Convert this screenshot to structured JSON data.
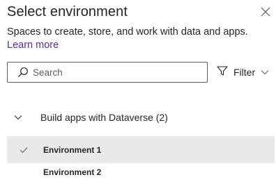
{
  "panel": {
    "title": "Select environment",
    "description": "Spaces to create, store, and work with data and apps.",
    "learn_more": "Learn more"
  },
  "search": {
    "placeholder": "Search",
    "value": ""
  },
  "filter": {
    "label": "Filter"
  },
  "groups": [
    {
      "label": "Build apps with Dataverse (2)",
      "expanded": true,
      "items": [
        {
          "name": "Environment 1",
          "selected": true
        },
        {
          "name": "Environment 2",
          "selected": false
        }
      ]
    }
  ],
  "icons": {
    "close": "close-icon",
    "search": "search-icon",
    "filter": "filter-icon",
    "filter_chevron": "chevron-down-icon",
    "group_chevron": "chevron-down-icon",
    "check": "checkmark-icon"
  },
  "colors": {
    "link": "#5b2d90",
    "selected_row": "#e9e9e9",
    "text": "#242424"
  }
}
